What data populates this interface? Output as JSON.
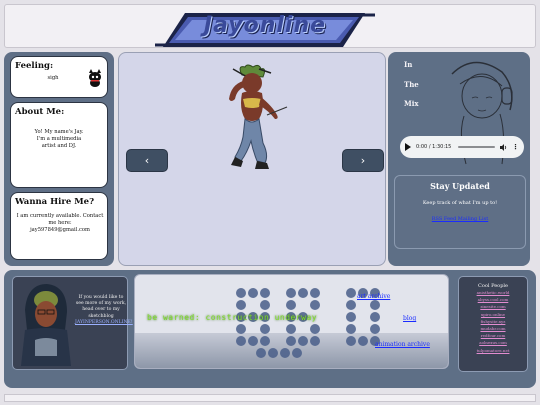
{
  "header": {
    "logo_text": "Jayonline"
  },
  "feeling": {
    "title": "Feeling:",
    "value": "sigh"
  },
  "about": {
    "title": "About Me:",
    "text": "Yo! My name's Jay. I'm a multimedia artist and DJ."
  },
  "hire": {
    "title": "Wanna Hire Me?",
    "text": "I am currently available. Contact me here:",
    "email": "jay597849@gmail.com"
  },
  "gallery": {
    "prev_label": "‹",
    "next_label": "›"
  },
  "mix": {
    "word1": "In",
    "word2": "The",
    "word3": "Mix",
    "audio_time": "0:00 / 1:30:15"
  },
  "stay": {
    "title": "Stay Updated",
    "text": "Keep track of what I'm up to!",
    "link": "RSS Feed Mailing List"
  },
  "contact": {
    "text": "If you would like to see more of my work, head over to my sketchblog",
    "link": "JAYINPERSON.ONLINE!"
  },
  "links": {
    "marquee": "be warned: construction underway",
    "art_archive": "art archive",
    "blog": "blog",
    "animation_archive": "animation archive"
  },
  "cool_people": {
    "title": "Cool People",
    "links": [
      "anisthetic.world",
      "abyss.cool.com",
      "zinesite.com",
      "xpiro.online",
      "fishysite.xyz",
      "mudahr.com",
      "redfour.com",
      "aolnexus.com",
      "tulpomatoes.net"
    ]
  },
  "colors": {
    "panel_blue": "#5f6f86",
    "gallery_bg": "#d4d6e9",
    "link_blue": "#1a2cff",
    "marquee_green": "#7fdc2a"
  }
}
